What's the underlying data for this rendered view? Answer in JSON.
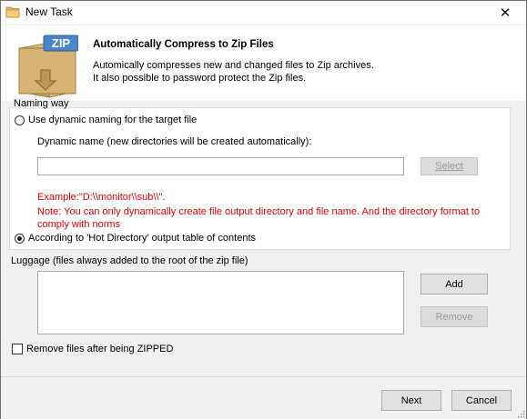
{
  "window": {
    "title": "New Task",
    "close_glyph": "✕"
  },
  "header": {
    "title": "Automatically Compress to Zip Files",
    "desc_line1": "Automically compresses new and changed files to Zip archives.",
    "desc_line2": "It  also possible to password protect the Zip files.",
    "zip_badge": "ZIP"
  },
  "naming": {
    "legend": "Naming way",
    "option_dynamic": {
      "label": "Use dynamic naming for the target file",
      "checked": false
    },
    "dynamic_name_label": "Dynamic name (new directories will be created automatically):",
    "dynamic_name_value": "",
    "select_button": "Select",
    "example": "Example:\"D:\\\\monitor\\\\sub\\\\\".",
    "note_line1": "Note: You can only dynamically create file output directory and file name. And the directory format to",
    "note_line2": "comply with norms",
    "option_hot": {
      "label": "According to 'Hot Directory' output table of contents",
      "checked": true
    }
  },
  "luggage": {
    "label": "Luggage (files always added to the root of the zip file)",
    "items": [],
    "add_button": "Add",
    "remove_button": "Remove"
  },
  "remove_after": {
    "label": "Remove files after being ZIPPED",
    "checked": false
  },
  "footer": {
    "next_button": "Next",
    "cancel_button": "Cancel"
  },
  "colors": {
    "note_red": "#e00000",
    "window_bg": "#f0f0f0",
    "header_bg": "#ffffff"
  }
}
